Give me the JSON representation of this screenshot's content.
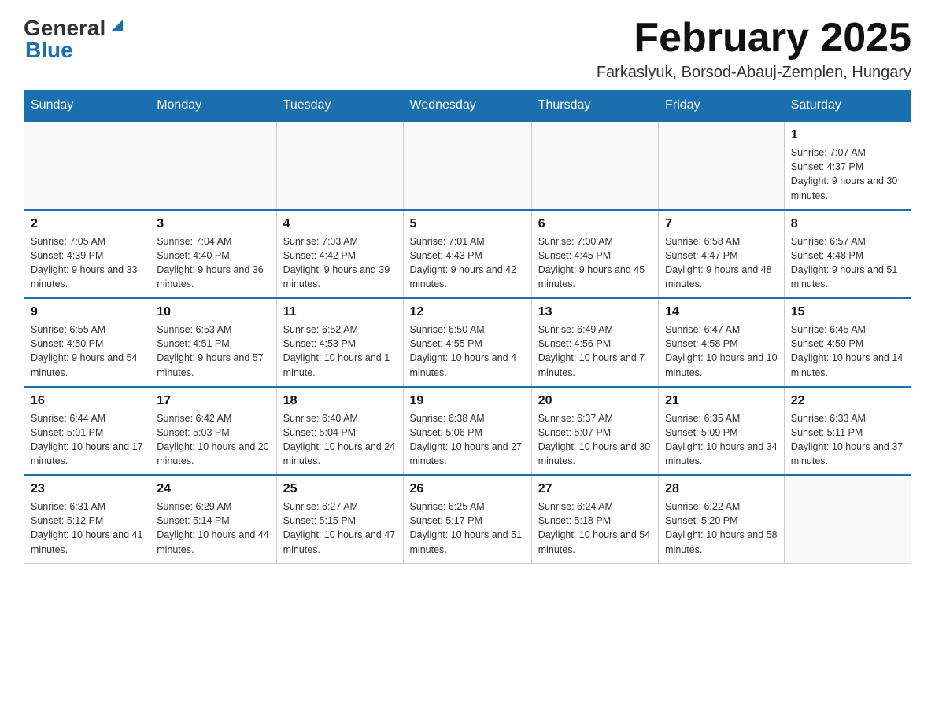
{
  "header": {
    "logo_main": "General",
    "logo_accent": "Blue",
    "month_title": "February 2025",
    "location": "Farkaslyuk, Borsod-Abauj-Zemplen, Hungary"
  },
  "days_of_week": [
    "Sunday",
    "Monday",
    "Tuesday",
    "Wednesday",
    "Thursday",
    "Friday",
    "Saturday"
  ],
  "weeks": [
    [
      {
        "day": "",
        "info": ""
      },
      {
        "day": "",
        "info": ""
      },
      {
        "day": "",
        "info": ""
      },
      {
        "day": "",
        "info": ""
      },
      {
        "day": "",
        "info": ""
      },
      {
        "day": "",
        "info": ""
      },
      {
        "day": "1",
        "info": "Sunrise: 7:07 AM\nSunset: 4:37 PM\nDaylight: 9 hours and 30 minutes."
      }
    ],
    [
      {
        "day": "2",
        "info": "Sunrise: 7:05 AM\nSunset: 4:39 PM\nDaylight: 9 hours and 33 minutes."
      },
      {
        "day": "3",
        "info": "Sunrise: 7:04 AM\nSunset: 4:40 PM\nDaylight: 9 hours and 36 minutes."
      },
      {
        "day": "4",
        "info": "Sunrise: 7:03 AM\nSunset: 4:42 PM\nDaylight: 9 hours and 39 minutes."
      },
      {
        "day": "5",
        "info": "Sunrise: 7:01 AM\nSunset: 4:43 PM\nDaylight: 9 hours and 42 minutes."
      },
      {
        "day": "6",
        "info": "Sunrise: 7:00 AM\nSunset: 4:45 PM\nDaylight: 9 hours and 45 minutes."
      },
      {
        "day": "7",
        "info": "Sunrise: 6:58 AM\nSunset: 4:47 PM\nDaylight: 9 hours and 48 minutes."
      },
      {
        "day": "8",
        "info": "Sunrise: 6:57 AM\nSunset: 4:48 PM\nDaylight: 9 hours and 51 minutes."
      }
    ],
    [
      {
        "day": "9",
        "info": "Sunrise: 6:55 AM\nSunset: 4:50 PM\nDaylight: 9 hours and 54 minutes."
      },
      {
        "day": "10",
        "info": "Sunrise: 6:53 AM\nSunset: 4:51 PM\nDaylight: 9 hours and 57 minutes."
      },
      {
        "day": "11",
        "info": "Sunrise: 6:52 AM\nSunset: 4:53 PM\nDaylight: 10 hours and 1 minute."
      },
      {
        "day": "12",
        "info": "Sunrise: 6:50 AM\nSunset: 4:55 PM\nDaylight: 10 hours and 4 minutes."
      },
      {
        "day": "13",
        "info": "Sunrise: 6:49 AM\nSunset: 4:56 PM\nDaylight: 10 hours and 7 minutes."
      },
      {
        "day": "14",
        "info": "Sunrise: 6:47 AM\nSunset: 4:58 PM\nDaylight: 10 hours and 10 minutes."
      },
      {
        "day": "15",
        "info": "Sunrise: 6:45 AM\nSunset: 4:59 PM\nDaylight: 10 hours and 14 minutes."
      }
    ],
    [
      {
        "day": "16",
        "info": "Sunrise: 6:44 AM\nSunset: 5:01 PM\nDaylight: 10 hours and 17 minutes."
      },
      {
        "day": "17",
        "info": "Sunrise: 6:42 AM\nSunset: 5:03 PM\nDaylight: 10 hours and 20 minutes."
      },
      {
        "day": "18",
        "info": "Sunrise: 6:40 AM\nSunset: 5:04 PM\nDaylight: 10 hours and 24 minutes."
      },
      {
        "day": "19",
        "info": "Sunrise: 6:38 AM\nSunset: 5:06 PM\nDaylight: 10 hours and 27 minutes."
      },
      {
        "day": "20",
        "info": "Sunrise: 6:37 AM\nSunset: 5:07 PM\nDaylight: 10 hours and 30 minutes."
      },
      {
        "day": "21",
        "info": "Sunrise: 6:35 AM\nSunset: 5:09 PM\nDaylight: 10 hours and 34 minutes."
      },
      {
        "day": "22",
        "info": "Sunrise: 6:33 AM\nSunset: 5:11 PM\nDaylight: 10 hours and 37 minutes."
      }
    ],
    [
      {
        "day": "23",
        "info": "Sunrise: 6:31 AM\nSunset: 5:12 PM\nDaylight: 10 hours and 41 minutes."
      },
      {
        "day": "24",
        "info": "Sunrise: 6:29 AM\nSunset: 5:14 PM\nDaylight: 10 hours and 44 minutes."
      },
      {
        "day": "25",
        "info": "Sunrise: 6:27 AM\nSunset: 5:15 PM\nDaylight: 10 hours and 47 minutes."
      },
      {
        "day": "26",
        "info": "Sunrise: 6:25 AM\nSunset: 5:17 PM\nDaylight: 10 hours and 51 minutes."
      },
      {
        "day": "27",
        "info": "Sunrise: 6:24 AM\nSunset: 5:18 PM\nDaylight: 10 hours and 54 minutes."
      },
      {
        "day": "28",
        "info": "Sunrise: 6:22 AM\nSunset: 5:20 PM\nDaylight: 10 hours and 58 minutes."
      },
      {
        "day": "",
        "info": ""
      }
    ]
  ]
}
